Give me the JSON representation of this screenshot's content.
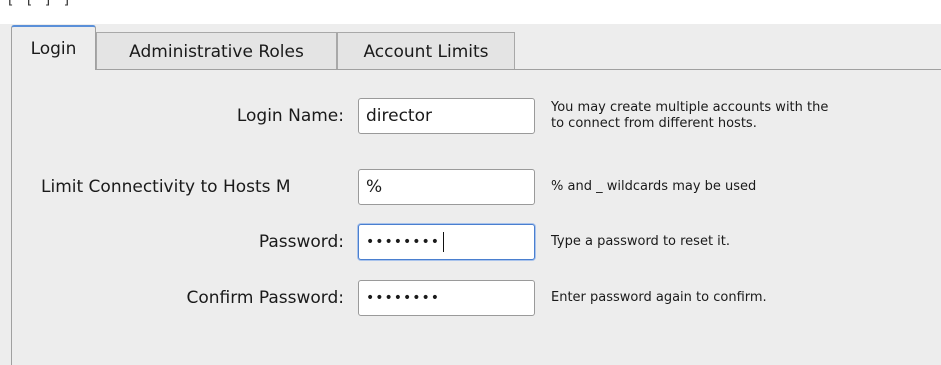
{
  "window": {
    "top_fragment": "[ [ ] ]"
  },
  "tabs": [
    {
      "label": "Login",
      "active": true
    },
    {
      "label": "Administrative Roles",
      "active": false
    },
    {
      "label": "Account Limits",
      "active": false
    }
  ],
  "form": {
    "login_name": {
      "label": "Login Name:",
      "value": "director",
      "hint_line1": "You may create multiple accounts with the",
      "hint_line2": "to connect from different hosts."
    },
    "hosts": {
      "label": "Limit Connectivity to Hosts M",
      "value": "%",
      "hint": "% and _ wildcards may be used"
    },
    "password": {
      "label": "Password:",
      "value": "••••••••",
      "hint": "Type a password to reset it."
    },
    "confirm": {
      "label": "Confirm Password:",
      "value": "••••••••",
      "hint": "Enter password again to confirm."
    }
  },
  "colors": {
    "background": "#ededed",
    "focus_border": "#4a7fcf",
    "active_tab_accent": "#5a8fd8"
  }
}
